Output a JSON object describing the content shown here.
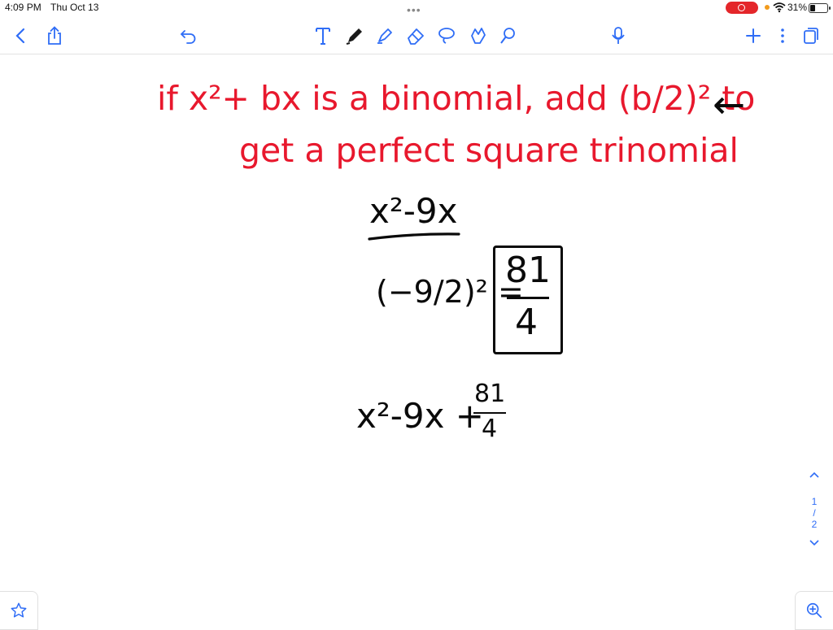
{
  "status_bar": {
    "time": "4:09 PM",
    "date": "Thu Oct 13",
    "battery_percent": "31%",
    "battery_level": 0.31,
    "recording": true
  },
  "toolbar": {
    "left_icons": [
      "back-icon",
      "share-icon",
      "undo-icon"
    ],
    "tools": [
      "text-tool-icon",
      "pen-icon",
      "highlighter-icon",
      "eraser-icon",
      "lasso-icon",
      "image-icon",
      "shapes-icon"
    ],
    "right_icons": [
      "microphone-icon",
      "add-page-icon",
      "more-icon",
      "pages-icon"
    ],
    "selected_tool": "pen-icon",
    "accent_color": "#2f6df6"
  },
  "note": {
    "rule_line1": "if x²+ bx is a binomial, add (b/2)² to",
    "rule_line2": "get a perfect square trinomial",
    "arrow": "←",
    "binomial": "x²-9x",
    "step_lhs": "(−9/2)² =",
    "boxed_numerator": "81",
    "boxed_denominator": "4",
    "result_prefix": "x²-9x +",
    "result_numerator": "81",
    "result_denominator": "4",
    "ink_colors": {
      "red": "#e8182d",
      "black": "#0a0a0a"
    }
  },
  "pager": {
    "current": "1",
    "separator": "/",
    "total": "2"
  },
  "bottom": {
    "favorite_icon": "star-icon",
    "zoom_icon": "zoom-in-icon"
  }
}
